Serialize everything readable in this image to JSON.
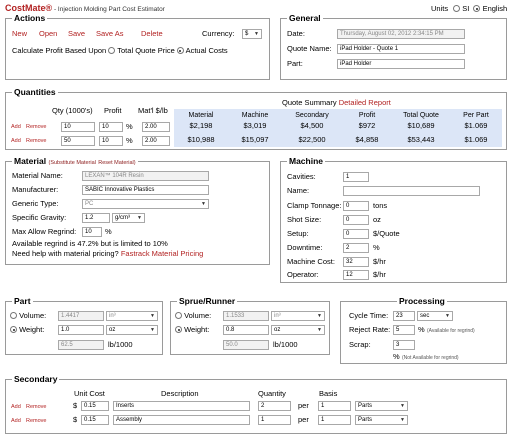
{
  "header": {
    "logo": "CostMate®",
    "subtitle": " - Injection Molding Part Cost Estimator",
    "units_label": "Units",
    "unit_si": "SI",
    "unit_english": "English"
  },
  "actions": {
    "legend": "Actions",
    "new": "New",
    "open": "Open",
    "save": "Save",
    "save_as": "Save As",
    "delete": "Delete",
    "currency_label": "Currency:",
    "currency_value": "$",
    "calc_label": "Calculate Profit Based Upon",
    "total_quote_price": "Total Quote Price",
    "actual_costs": "Actual Costs"
  },
  "general": {
    "legend": "General",
    "date_label": "Date:",
    "date_value": "Thursday, August 02, 2012 2:34:15 PM",
    "quote_label": "Quote Name:",
    "quote_value": "iPad Holder - Quote 1",
    "part_label": "Part:",
    "part_value": "iPad Holder"
  },
  "quantities": {
    "legend": "Quantities",
    "col_qty": "Qty (1000's)",
    "col_profit": "Profit",
    "col_mat": "Mat'l $/lb",
    "summary_title": "Quote Summary",
    "detailed_report": "Detailed Report",
    "sum_cols": [
      "Material",
      "Machine",
      "Secondary",
      "Profit",
      "Total Quote",
      "Per Part"
    ],
    "rows": [
      {
        "add": "Add",
        "remove": "Remove",
        "qty": "10",
        "profit": "10",
        "pct": "%",
        "mat": "2.00",
        "summary": [
          "$2,198",
          "$3,019",
          "$4,500",
          "$972",
          "$10,689",
          "$1.069"
        ]
      },
      {
        "add": "Add",
        "remove": "Remove",
        "qty": "50",
        "profit": "10",
        "pct": "%",
        "mat": "2.00",
        "summary": [
          "$10,988",
          "$15,097",
          "$22,500",
          "$4,858",
          "$53,443",
          "$1.069"
        ]
      }
    ]
  },
  "material": {
    "legend": "Material",
    "substitute": "(Substitute Material",
    "reset": "Reset Material)",
    "name_label": "Material Name:",
    "name_value": "LEXAN™ 104R Resin",
    "mfr_label": "Manufacturer:",
    "mfr_value": "SABIC Innovative Plastics",
    "type_label": "Generic Type:",
    "type_value": "PC",
    "sg_label": "Specific Gravity:",
    "sg_value": "1.2",
    "sg_unit": "g/cm³",
    "regrind_label": "Max Allow Regrind:",
    "regrind_value": "10",
    "regrind_unit": "%",
    "regrind_note": "Available regrind is 47.2% but is limited to 10%",
    "help_text": "Need help with material pricing?",
    "fastrack": "Fastrack Material Pricing"
  },
  "machine": {
    "legend": "Machine",
    "cavities_label": "Cavities:",
    "cavities_value": "1",
    "name_label": "Name:",
    "name_value": "",
    "clamp_label": "Clamp Tonnage:",
    "clamp_value": "0",
    "clamp_unit": "tons",
    "shot_label": "Shot Size:",
    "shot_value": "0",
    "shot_unit": "oz",
    "setup_label": "Setup:",
    "setup_value": "0",
    "setup_unit": "$/Quote",
    "downtime_label": "Downtime:",
    "downtime_value": "2",
    "downtime_unit": "%",
    "cost_label": "Machine Cost:",
    "cost_value": "32",
    "cost_unit": "$/hr",
    "operator_label": "Operator:",
    "operator_value": "12",
    "operator_unit": "$/hr"
  },
  "part": {
    "legend": "Part",
    "volume_label": "Volume:",
    "volume_value": "1.4417",
    "volume_unit": "in³",
    "weight_label": "Weight:",
    "weight_value": "1.0",
    "weight_unit": "oz",
    "lb_value": "62.5",
    "lb_unit": "lb/1000"
  },
  "sprue": {
    "legend": "Sprue/Runner",
    "volume_label": "Volume:",
    "volume_value": "1.1533",
    "volume_unit": "in³",
    "weight_label": "Weight:",
    "weight_value": "0.8",
    "weight_unit": "oz",
    "lb_value": "50.0",
    "lb_unit": "lb/1000"
  },
  "processing": {
    "legend": "Processing",
    "cycle_label": "Cycle Time:",
    "cycle_value": "23",
    "cycle_unit": "sec",
    "reject_label": "Reject Rate:",
    "reject_value": "5",
    "reject_pct": "%",
    "reject_note": "(Available for regrind)",
    "scrap_label": "Scrap:",
    "scrap_value": "3",
    "scrap_pct": "%",
    "scrap_note": "(Not Available for regrind)"
  },
  "secondary": {
    "legend": "Secondary",
    "col_unit_cost": "Unit Cost",
    "col_description": "Description",
    "col_quantity": "Quantity",
    "col_basis": "Basis",
    "rows": [
      {
        "add": "Add",
        "remove": "Remove",
        "cur": "$",
        "cost": "0.15",
        "desc": "Inserts",
        "qty": "2",
        "per": "per",
        "basis": "1",
        "unit": "Parts"
      },
      {
        "add": "Add",
        "remove": "Remove",
        "cur": "$",
        "cost": "0.15",
        "desc": "Assembly",
        "qty": "1",
        "per": "per",
        "basis": "1",
        "unit": "Parts"
      }
    ]
  },
  "colors": {
    "accent": "#b22222",
    "summary_bg": "#dce6f7",
    "border": "#9a9a9a"
  }
}
